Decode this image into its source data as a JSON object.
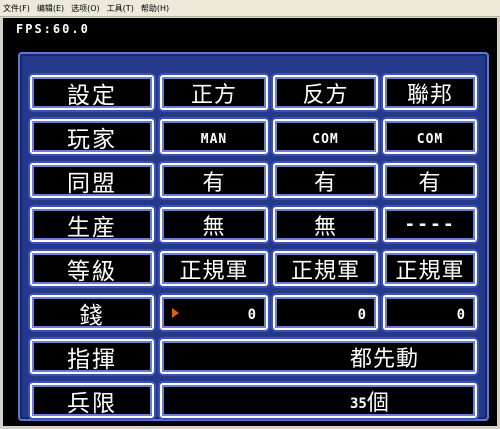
{
  "menubar": {
    "items": [
      {
        "label": "文件(F)"
      },
      {
        "label": "编辑(E)"
      },
      {
        "label": "选项(O)"
      },
      {
        "label": "工具(T)"
      },
      {
        "label": "帮助(H)"
      }
    ]
  },
  "screen": {
    "fps_text": "FPS:60.0"
  },
  "settings": {
    "header": {
      "label": "設定",
      "cols": [
        "正方",
        "反方",
        "聯邦"
      ]
    },
    "rows": [
      {
        "label": "玩家",
        "values": [
          "MAN",
          "COM",
          "COM"
        ]
      },
      {
        "label": "同盟",
        "values": [
          "有",
          "有",
          "有"
        ]
      },
      {
        "label": "生産",
        "values": [
          "無",
          "無",
          "----"
        ]
      },
      {
        "label": "等級",
        "values": [
          "正規軍",
          "正規軍",
          "正規軍"
        ]
      },
      {
        "label": "錢",
        "values": [
          "0",
          "0",
          "0"
        ]
      }
    ],
    "command": {
      "label": "指揮",
      "value": "都先動"
    },
    "troop_limit": {
      "label": "兵限",
      "number": "35",
      "unit": "個"
    }
  },
  "colors": {
    "panel_blue": "#24388c",
    "cell_border": "#ffffff",
    "cursor": "#e0601a"
  }
}
